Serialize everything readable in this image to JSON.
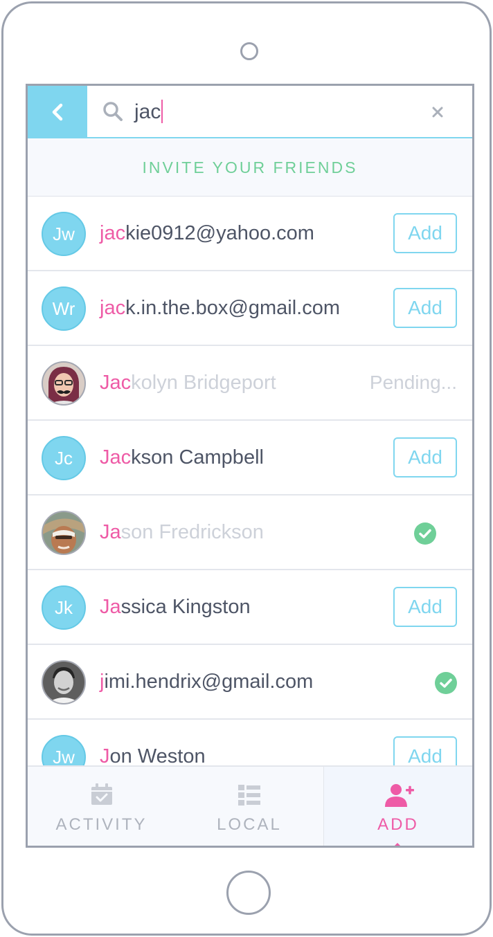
{
  "search": {
    "query": "jac"
  },
  "banner": {
    "label": "INVITE YOUR FRIENDS"
  },
  "contacts": [
    {
      "initials": "Jw",
      "highlight": "jac",
      "rest": "kie0912@yahoo.com",
      "status": "add",
      "action_label": "Add"
    },
    {
      "initials": "Wr",
      "highlight": "jac",
      "rest": "k.in.the.box@gmail.com",
      "status": "add",
      "action_label": "Add"
    },
    {
      "initials": "",
      "highlight": "Jac",
      "rest": "kolyn Bridgeport",
      "status": "pending",
      "action_label": "Pending..."
    },
    {
      "initials": "Jc",
      "highlight": "Jac",
      "rest": "kson Campbell",
      "status": "add",
      "action_label": "Add"
    },
    {
      "initials": "",
      "highlight": "Ja",
      "rest": "son Fredrickson",
      "status": "added",
      "action_label": ""
    },
    {
      "initials": "Jk",
      "highlight": "Ja",
      "rest": "ssica Kingston",
      "status": "add",
      "action_label": "Add"
    },
    {
      "initials": "",
      "highlight": "j",
      "rest": "imi.hendrix@gmail.com",
      "status": "added",
      "action_label": ""
    },
    {
      "initials": "Jw",
      "highlight": "J",
      "rest": "on Weston",
      "status": "add",
      "action_label": "Add"
    }
  ],
  "tabs": [
    {
      "label": "ACTIVITY",
      "icon": "calendar-check-icon"
    },
    {
      "label": "LOCAL",
      "icon": "list-icon"
    },
    {
      "label": "ADD",
      "icon": "add-user-icon",
      "active": true
    }
  ],
  "colors": {
    "accent_blue": "#7fd6ef",
    "highlight_pink": "#ee5ba6",
    "confirm_green": "#6fcf98",
    "text_dark": "#4e5566",
    "text_faded": "#cdd1d9"
  }
}
